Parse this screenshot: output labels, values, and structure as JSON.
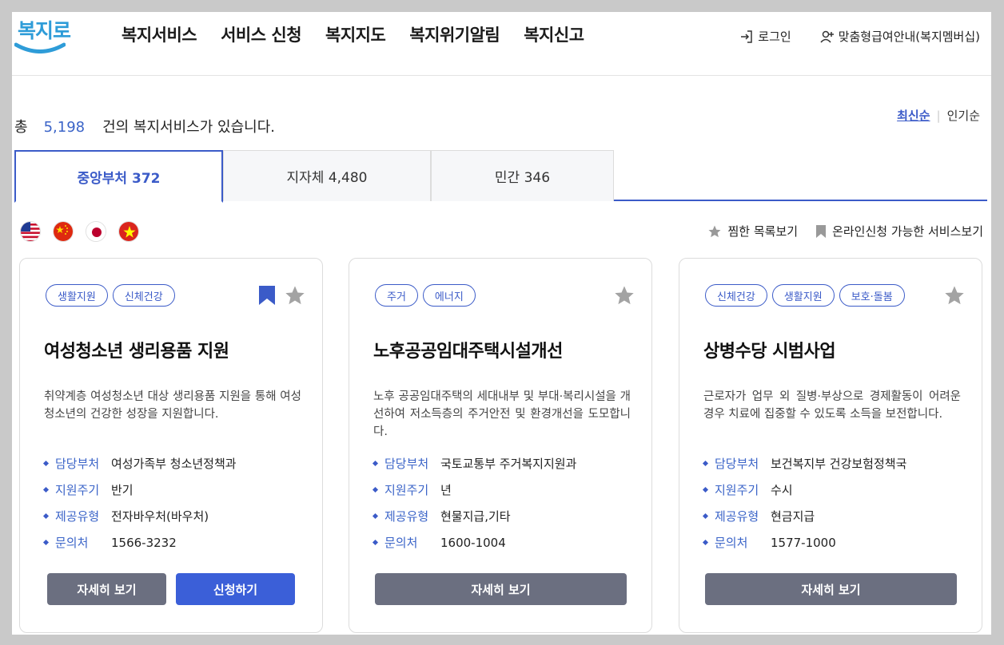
{
  "header": {
    "logo_text": "복지로",
    "nav": [
      "복지서비스",
      "서비스 신청",
      "복지지도",
      "복지위기알림",
      "복지신고"
    ],
    "login": "로그인",
    "membership": "맞춤형급여안내(복지멤버십)"
  },
  "summary": {
    "prefix": "총",
    "count": "5,198",
    "suffix": "건의 복지서비스가 있습니다."
  },
  "sort": {
    "latest": "최신순",
    "popular": "인기순"
  },
  "tabs": [
    {
      "label": "중앙부처 372",
      "active": true
    },
    {
      "label": "지자체 4,480",
      "active": false
    },
    {
      "label": "민간 346",
      "active": false
    }
  ],
  "languages": [
    "us-flag-icon",
    "china-flag-icon",
    "japan-flag-icon",
    "vietnam-flag-icon"
  ],
  "view_options": {
    "favorites": "찜한 목록보기",
    "online": "온라인신청 가능한 서비스보기"
  },
  "colors": {
    "accent": "#3b5bc8",
    "button_gray": "#6b6f80",
    "button_blue": "#3b5fd8"
  },
  "cards": [
    {
      "tags": [
        "생활지원",
        "신체건강"
      ],
      "bookmarked": true,
      "title": "여성청소년 생리용품 지원",
      "desc": "취약계층 여성청소년 대상 생리용품 지원을 통해 여성 청소년의 건강한 성장을 지원합니다.",
      "info": [
        {
          "label": "담당부처",
          "value": "여성가족부 청소년정책과"
        },
        {
          "label": "지원주기",
          "value": "반기"
        },
        {
          "label": "제공유형",
          "value": "전자바우처(바우처)"
        },
        {
          "label": "문의처",
          "value": "1566-3232"
        }
      ],
      "detail_btn": "자세히 보기",
      "apply_btn": "신청하기"
    },
    {
      "tags": [
        "주거",
        "에너지"
      ],
      "bookmarked": false,
      "title": "노후공공임대주택시설개선",
      "desc": "노후 공공임대주택의 세대내부 및 부대·복리시설을 개선하여 저소득층의 주거안전 및 환경개선을 도모합니다.",
      "info": [
        {
          "label": "담당부처",
          "value": "국토교통부 주거복지지원과"
        },
        {
          "label": "지원주기",
          "value": "년"
        },
        {
          "label": "제공유형",
          "value": "현물지급,기타"
        },
        {
          "label": "문의처",
          "value": "1600-1004"
        }
      ],
      "detail_btn": "자세히 보기"
    },
    {
      "tags": [
        "신체건강",
        "생활지원",
        "보호·돌봄"
      ],
      "bookmarked": false,
      "title": "상병수당 시범사업",
      "desc": "근로자가 업무 외 질병·부상으로 경제활동이 어려운 경우 치료에 집중할 수 있도록 소득을 보전합니다.",
      "info": [
        {
          "label": "담당부처",
          "value": "보건복지부 건강보험정책국"
        },
        {
          "label": "지원주기",
          "value": "수시"
        },
        {
          "label": "제공유형",
          "value": "현금지급"
        },
        {
          "label": "문의처",
          "value": "1577-1000"
        }
      ],
      "detail_btn": "자세히 보기"
    }
  ]
}
